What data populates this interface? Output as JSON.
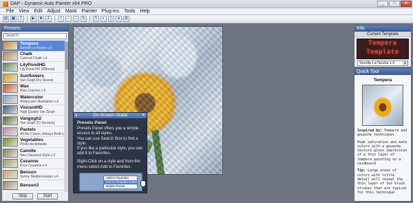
{
  "window": {
    "title": "DAP - Dynamic Auto Painter x64 PRO",
    "controls": [
      "_",
      "□",
      "✕"
    ]
  },
  "menu": [
    "File",
    "View",
    "Edit",
    "Adjust",
    "Mask",
    "Painter",
    "Plug-ins",
    "Tools",
    "Help"
  ],
  "presets": {
    "header": "Presets",
    "search_placeholder": "Search",
    "items": [
      {
        "name": "Tempera",
        "sub": "Sorolla La Nostra v.3",
        "selected": true,
        "color": "#c98a33"
      },
      {
        "name": "Chalk",
        "sub": "Colored Chalk v.4",
        "selected": false,
        "color": "#a98b6a"
      },
      {
        "name": "LilyPondHD",
        "sub": "Lily Pond HD (6Monet)",
        "selected": false,
        "color": "#5a8a6a"
      },
      {
        "name": "Sunflowers",
        "sub": "Van Gogh Dry Reveal",
        "selected": false,
        "color": "#d6a21f"
      },
      {
        "name": "Wax",
        "sub": "Wax Crayons v.5",
        "selected": false,
        "color": "#c2552e"
      },
      {
        "name": "Watercolor",
        "sub": "Watercolor Illustration v.4",
        "selected": false,
        "color": "#7fa5c9"
      },
      {
        "name": "VincentHD",
        "sub": "High Quality Van Gogh",
        "selected": false,
        "color": "#3d5d8f"
      },
      {
        "name": "Vangogh2",
        "sub": "Van Gogh 2D Scratchy",
        "selected": false,
        "color": "#4f6f3a"
      },
      {
        "name": "Pastels",
        "sub": "All the Colors, Always Bold v.4",
        "selected": false,
        "color": "#b98fb3"
      },
      {
        "name": "Vegetables",
        "sub": "Photo Arcimboldo",
        "selected": false,
        "color": "#6b8e2f"
      },
      {
        "name": "Camille",
        "sub": "Neo-Classical Style v.3",
        "selected": false,
        "color": "#8a7a64"
      },
      {
        "name": "Cezanne",
        "sub": "Post Cezanne v.4",
        "selected": false,
        "color": "#8fa36b"
      },
      {
        "name": "Benson",
        "sub": "Sunny Mediterranean v.4",
        "selected": false,
        "color": "#c7a56a"
      },
      {
        "name": "Benson3",
        "sub": "",
        "selected": false,
        "color": "#9c8a70"
      }
    ],
    "buttons": {
      "stop": "Stop",
      "start": "Start"
    }
  },
  "guide": {
    "header": "On-Screen Guide",
    "title": "Presets Panel",
    "paragraphs": [
      "Presets Panel offers you a simple access to all styles.",
      "You can use Search Box to find a style.",
      "If you like a particular style, you can add it to Favorites.",
      "Right-Click on a style and from the menu select Add to Favorites."
    ],
    "menu_items": [
      "Add to Favorites",
      "Edit in Template Editor",
      "Delete Preset"
    ]
  },
  "info": {
    "header": "Info",
    "current_template_label": "Current Template",
    "led_lines": [
      "Tempera",
      "Template"
    ],
    "variant": "Sorolla La Nostra v.3"
  },
  "quick_tool": {
    "header": "Quick Tool",
    "name": "Tempera",
    "inspired_label": "Inspired by:",
    "inspired_text": "Tempera and gouache techniques",
    "desc": "Peak saturation and mate colors with a gouache texture gives impression of a thin layer of tempera painting on a cardboard",
    "tip_label": "Tip:",
    "tip_text": "Large areas of colors with little detail will reveal the thin layer of fat brush strokes that are typical for this technique"
  }
}
